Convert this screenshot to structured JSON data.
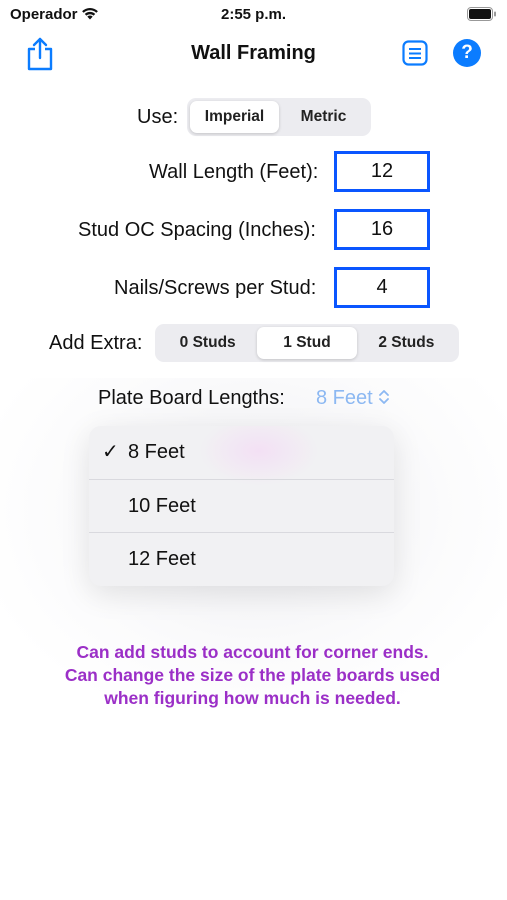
{
  "status_bar": {
    "carrier": "Operador",
    "time": "2:55 p.m."
  },
  "nav": {
    "title": "Wall Framing",
    "help_label": "?"
  },
  "units": {
    "label": "Use:",
    "options": [
      "Imperial",
      "Metric"
    ],
    "selected": "Imperial"
  },
  "inputs": {
    "wall_length": {
      "label": "Wall Length (Feet):",
      "value": "12"
    },
    "stud_spacing": {
      "label": "Stud OC Spacing (Inches):",
      "value": "16"
    },
    "nails_per_stud": {
      "label": "Nails/Screws per Stud:",
      "value": "4"
    }
  },
  "extra": {
    "label": "Add Extra:",
    "options": [
      "0 Studs",
      "1 Stud",
      "2 Studs"
    ],
    "selected": "1 Stud"
  },
  "plate": {
    "label": "Plate Board Lengths:",
    "value": "8 Feet",
    "options": [
      {
        "label": "8 Feet",
        "checked": true,
        "check": "✓"
      },
      {
        "label": "10 Feet",
        "checked": false
      },
      {
        "label": "12 Feet",
        "checked": false
      }
    ]
  },
  "hint_text": "Can add studs to account for corner ends. Can change the size of the plate boards used when figuring how much is needed.",
  "colors": {
    "accent": "#0a56ff",
    "help": "#0b7cff",
    "hint": "#9b2fc7",
    "picker": "#8cb8f2"
  }
}
